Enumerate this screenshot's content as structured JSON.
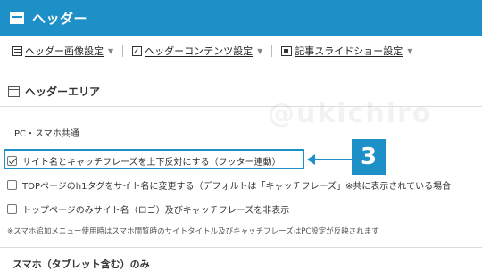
{
  "header": {
    "title": "ヘッダー",
    "icon": "window-icon",
    "color": "#1e90c8"
  },
  "nav": {
    "items": [
      {
        "label": "ヘッダー画像設定",
        "icon": "list-icon"
      },
      {
        "label": "ヘッダーコンテンツ設定",
        "icon": "edit-icon"
      },
      {
        "label": "記事スライドショー設定",
        "icon": "slideshow-icon"
      }
    ]
  },
  "section": {
    "title": "ヘッダーエリア",
    "icon": "window-icon"
  },
  "watermark": "@ukichiro",
  "subhead": "PC・スマホ共通",
  "options": [
    {
      "label": "サイト名とキャッチフレーズを上下反対にする（フッター連動）",
      "checked": true
    },
    {
      "label": "TOPページのh1タグをサイト名に変更する（デフォルトは「キャッチフレーズ」※共に表示されている場合",
      "checked": false
    },
    {
      "label": "トップページのみサイト名（ロゴ）及びキャッチフレーズを非表示",
      "checked": false
    }
  ],
  "annotation": {
    "step": "3"
  },
  "note": "※スマホ追加メニュー使用時はスマホ閲覧時のサイトタイトル及びキャッチフレーズはPC設定が反映されます",
  "section2": {
    "title": "スマホ（タブレット含む）のみ"
  }
}
